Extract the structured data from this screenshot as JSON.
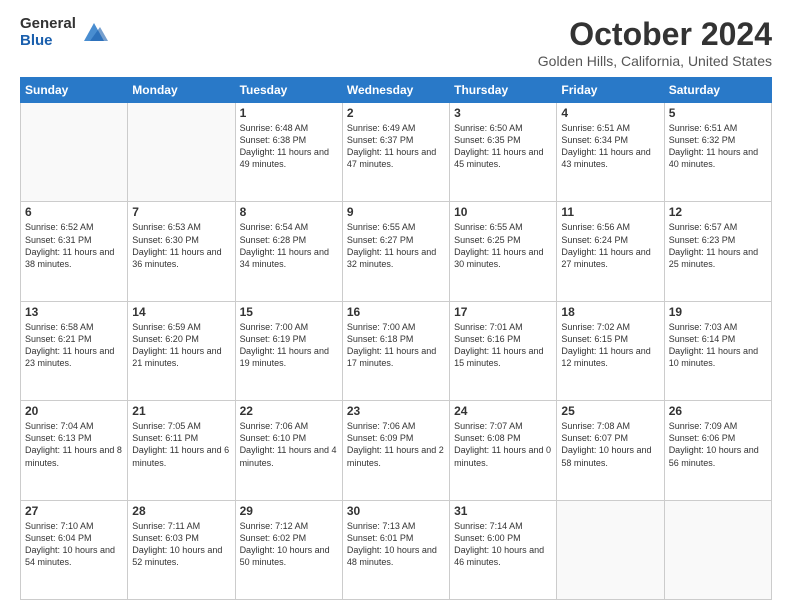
{
  "logo": {
    "general": "General",
    "blue": "Blue"
  },
  "title": "October 2024",
  "location": "Golden Hills, California, United States",
  "headers": [
    "Sunday",
    "Monday",
    "Tuesday",
    "Wednesday",
    "Thursday",
    "Friday",
    "Saturday"
  ],
  "weeks": [
    [
      {
        "day": "",
        "empty": true
      },
      {
        "day": "",
        "empty": true
      },
      {
        "day": "1",
        "sunrise": "Sunrise: 6:48 AM",
        "sunset": "Sunset: 6:38 PM",
        "daylight": "Daylight: 11 hours and 49 minutes."
      },
      {
        "day": "2",
        "sunrise": "Sunrise: 6:49 AM",
        "sunset": "Sunset: 6:37 PM",
        "daylight": "Daylight: 11 hours and 47 minutes."
      },
      {
        "day": "3",
        "sunrise": "Sunrise: 6:50 AM",
        "sunset": "Sunset: 6:35 PM",
        "daylight": "Daylight: 11 hours and 45 minutes."
      },
      {
        "day": "4",
        "sunrise": "Sunrise: 6:51 AM",
        "sunset": "Sunset: 6:34 PM",
        "daylight": "Daylight: 11 hours and 43 minutes."
      },
      {
        "day": "5",
        "sunrise": "Sunrise: 6:51 AM",
        "sunset": "Sunset: 6:32 PM",
        "daylight": "Daylight: 11 hours and 40 minutes."
      }
    ],
    [
      {
        "day": "6",
        "sunrise": "Sunrise: 6:52 AM",
        "sunset": "Sunset: 6:31 PM",
        "daylight": "Daylight: 11 hours and 38 minutes."
      },
      {
        "day": "7",
        "sunrise": "Sunrise: 6:53 AM",
        "sunset": "Sunset: 6:30 PM",
        "daylight": "Daylight: 11 hours and 36 minutes."
      },
      {
        "day": "8",
        "sunrise": "Sunrise: 6:54 AM",
        "sunset": "Sunset: 6:28 PM",
        "daylight": "Daylight: 11 hours and 34 minutes."
      },
      {
        "day": "9",
        "sunrise": "Sunrise: 6:55 AM",
        "sunset": "Sunset: 6:27 PM",
        "daylight": "Daylight: 11 hours and 32 minutes."
      },
      {
        "day": "10",
        "sunrise": "Sunrise: 6:55 AM",
        "sunset": "Sunset: 6:25 PM",
        "daylight": "Daylight: 11 hours and 30 minutes."
      },
      {
        "day": "11",
        "sunrise": "Sunrise: 6:56 AM",
        "sunset": "Sunset: 6:24 PM",
        "daylight": "Daylight: 11 hours and 27 minutes."
      },
      {
        "day": "12",
        "sunrise": "Sunrise: 6:57 AM",
        "sunset": "Sunset: 6:23 PM",
        "daylight": "Daylight: 11 hours and 25 minutes."
      }
    ],
    [
      {
        "day": "13",
        "sunrise": "Sunrise: 6:58 AM",
        "sunset": "Sunset: 6:21 PM",
        "daylight": "Daylight: 11 hours and 23 minutes."
      },
      {
        "day": "14",
        "sunrise": "Sunrise: 6:59 AM",
        "sunset": "Sunset: 6:20 PM",
        "daylight": "Daylight: 11 hours and 21 minutes."
      },
      {
        "day": "15",
        "sunrise": "Sunrise: 7:00 AM",
        "sunset": "Sunset: 6:19 PM",
        "daylight": "Daylight: 11 hours and 19 minutes."
      },
      {
        "day": "16",
        "sunrise": "Sunrise: 7:00 AM",
        "sunset": "Sunset: 6:18 PM",
        "daylight": "Daylight: 11 hours and 17 minutes."
      },
      {
        "day": "17",
        "sunrise": "Sunrise: 7:01 AM",
        "sunset": "Sunset: 6:16 PM",
        "daylight": "Daylight: 11 hours and 15 minutes."
      },
      {
        "day": "18",
        "sunrise": "Sunrise: 7:02 AM",
        "sunset": "Sunset: 6:15 PM",
        "daylight": "Daylight: 11 hours and 12 minutes."
      },
      {
        "day": "19",
        "sunrise": "Sunrise: 7:03 AM",
        "sunset": "Sunset: 6:14 PM",
        "daylight": "Daylight: 11 hours and 10 minutes."
      }
    ],
    [
      {
        "day": "20",
        "sunrise": "Sunrise: 7:04 AM",
        "sunset": "Sunset: 6:13 PM",
        "daylight": "Daylight: 11 hours and 8 minutes."
      },
      {
        "day": "21",
        "sunrise": "Sunrise: 7:05 AM",
        "sunset": "Sunset: 6:11 PM",
        "daylight": "Daylight: 11 hours and 6 minutes."
      },
      {
        "day": "22",
        "sunrise": "Sunrise: 7:06 AM",
        "sunset": "Sunset: 6:10 PM",
        "daylight": "Daylight: 11 hours and 4 minutes."
      },
      {
        "day": "23",
        "sunrise": "Sunrise: 7:06 AM",
        "sunset": "Sunset: 6:09 PM",
        "daylight": "Daylight: 11 hours and 2 minutes."
      },
      {
        "day": "24",
        "sunrise": "Sunrise: 7:07 AM",
        "sunset": "Sunset: 6:08 PM",
        "daylight": "Daylight: 11 hours and 0 minutes."
      },
      {
        "day": "25",
        "sunrise": "Sunrise: 7:08 AM",
        "sunset": "Sunset: 6:07 PM",
        "daylight": "Daylight: 10 hours and 58 minutes."
      },
      {
        "day": "26",
        "sunrise": "Sunrise: 7:09 AM",
        "sunset": "Sunset: 6:06 PM",
        "daylight": "Daylight: 10 hours and 56 minutes."
      }
    ],
    [
      {
        "day": "27",
        "sunrise": "Sunrise: 7:10 AM",
        "sunset": "Sunset: 6:04 PM",
        "daylight": "Daylight: 10 hours and 54 minutes."
      },
      {
        "day": "28",
        "sunrise": "Sunrise: 7:11 AM",
        "sunset": "Sunset: 6:03 PM",
        "daylight": "Daylight: 10 hours and 52 minutes."
      },
      {
        "day": "29",
        "sunrise": "Sunrise: 7:12 AM",
        "sunset": "Sunset: 6:02 PM",
        "daylight": "Daylight: 10 hours and 50 minutes."
      },
      {
        "day": "30",
        "sunrise": "Sunrise: 7:13 AM",
        "sunset": "Sunset: 6:01 PM",
        "daylight": "Daylight: 10 hours and 48 minutes."
      },
      {
        "day": "31",
        "sunrise": "Sunrise: 7:14 AM",
        "sunset": "Sunset: 6:00 PM",
        "daylight": "Daylight: 10 hours and 46 minutes."
      },
      {
        "day": "",
        "empty": true
      },
      {
        "day": "",
        "empty": true
      }
    ]
  ]
}
